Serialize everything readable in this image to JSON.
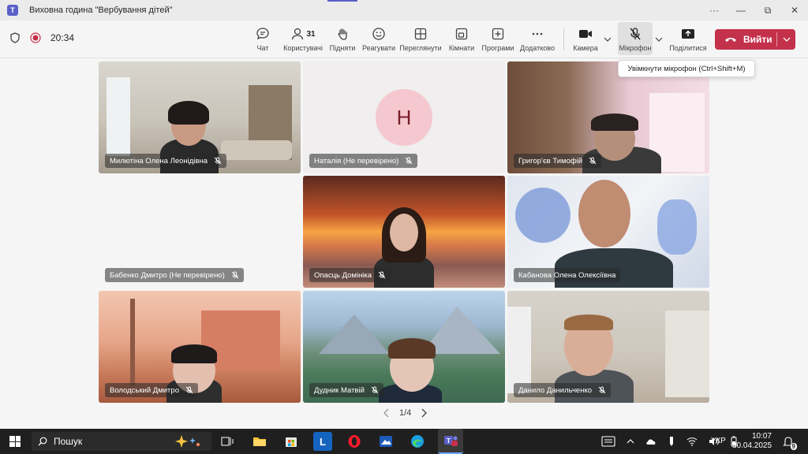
{
  "window": {
    "title": "Виховна година \"Вербування дітей\""
  },
  "toolbar": {
    "timer": "20:34",
    "participants_count": "31",
    "items": {
      "chat": "Чат",
      "people": "Користувачі",
      "raise": "Підняти",
      "react": "Реагувати",
      "view": "Переглянути",
      "rooms": "Кімнати",
      "apps": "Програми",
      "more": "Додатково",
      "camera": "Камера",
      "mic": "Мікрофон",
      "share": "Поділитися"
    },
    "leave": "Вийти"
  },
  "tooltip": "Увімкнути мікрофон (Ctrl+Shift+M)",
  "tiles": [
    {
      "name": "Милютіна Олена Леонідівна"
    },
    {
      "name": "Наталія (Не перевірено)",
      "initial": "Н"
    },
    {
      "name": "Григор'єв Тимофій"
    },
    {
      "name": "Бабенко Дмитро (Не перевірено)"
    },
    {
      "name": "Опасць Домініка"
    },
    {
      "name": "Кабанова Олена Олексіївна"
    },
    {
      "name": "Володський Дмитро"
    },
    {
      "name": "Дудник Матвій"
    },
    {
      "name": "Данило Данильченко"
    }
  ],
  "pager": "1/4",
  "taskbar": {
    "search": "Пошук",
    "lang": "УКР",
    "time": "10:07",
    "date": "30.04.2025",
    "notifications": "9"
  }
}
